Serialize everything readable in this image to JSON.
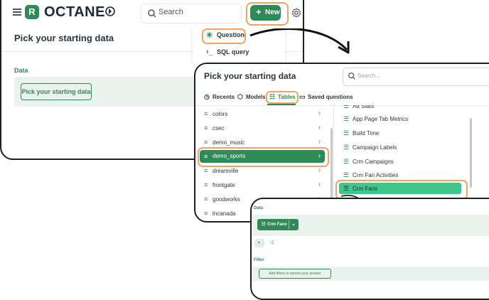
{
  "colors": {
    "brand": "#2e8b57",
    "highlight": "#f2a362",
    "selected_table": "#3fc78a"
  },
  "topbar": {
    "logo_letter": "R",
    "logo_text": "OCTANE",
    "search_label": "Search",
    "new_label": "New"
  },
  "panel1": {
    "title": "Pick your starting data",
    "data_label": "Data",
    "pick_button": "Pick your starting data"
  },
  "menu": {
    "items": [
      {
        "label": "Question",
        "icon": "question-icon"
      },
      {
        "label": "SQL query",
        "icon": "terminal-icon"
      }
    ]
  },
  "panel2": {
    "title": "Pick your starting data",
    "search_placeholder": "Search...",
    "tabs": [
      {
        "label": "Recents",
        "icon": "clock-icon"
      },
      {
        "label": "Models",
        "icon": "cube-icon"
      },
      {
        "label": "Tables",
        "icon": "table-icon",
        "active": true
      },
      {
        "label": "Saved questions",
        "icon": "folder-icon"
      }
    ],
    "databases": [
      "colors",
      "csec",
      "demo_music",
      "demo_sports",
      "dreamville",
      "frontgate",
      "goodworks",
      "lncanada"
    ],
    "selected_database": "demo_sports",
    "tables": [
      "Ad Stats",
      "App Page Tab Metrics",
      "Build Time",
      "Campaign Labels",
      "Crm Campaigns",
      "Crm Fan Activities",
      "Crm Fans"
    ],
    "selected_table": "Crm Fans"
  },
  "panel3": {
    "data_label": "Data",
    "table_pill": "Crm Fans",
    "filter_label": "Filter",
    "filter_button": "Add filters to narrow your answer"
  }
}
